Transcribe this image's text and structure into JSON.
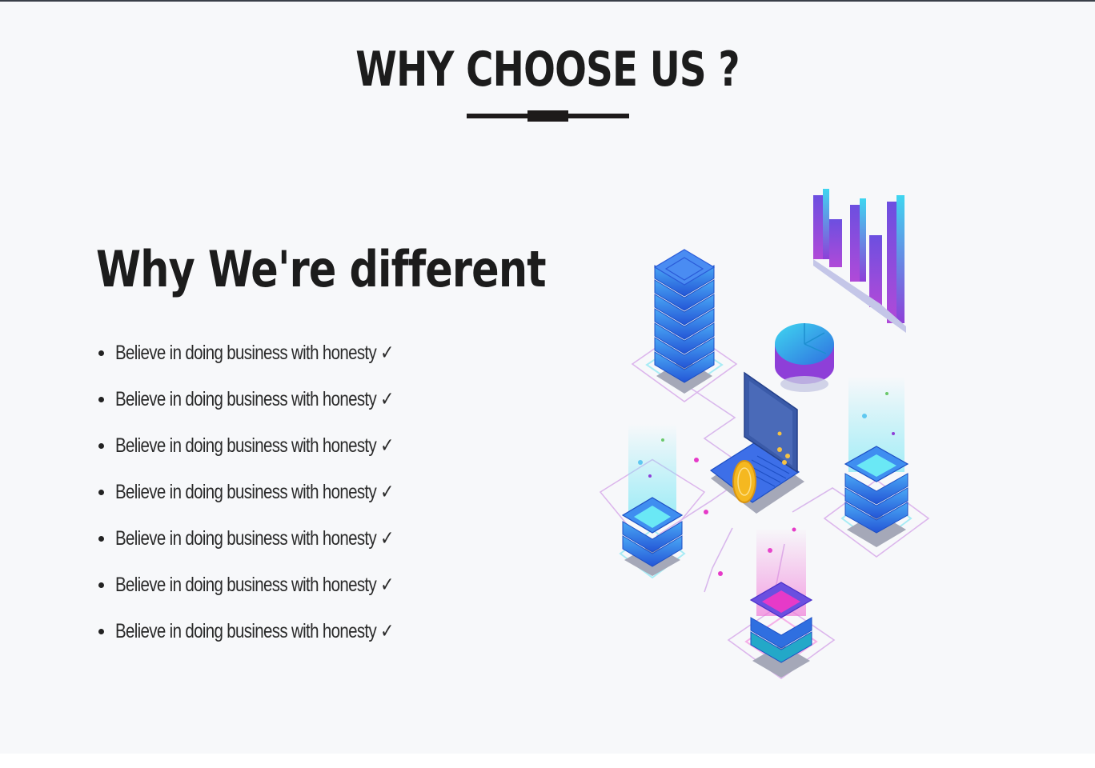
{
  "section": {
    "title": "WHY CHOOSE US ?",
    "subtitle": "Why We're different"
  },
  "features": [
    "Believe in doing business with honesty ✓",
    "Believe in doing business with honesty ✓",
    "Believe in doing business with honesty ✓",
    "Believe in doing business with honesty ✓",
    "Believe in doing business with honesty ✓",
    "Believe in doing business with honesty ✓",
    "Believe in doing business with honesty ✓"
  ],
  "colors": {
    "background": "#f7f8fa",
    "text": "#1c1c1c",
    "accent_blue": "#2f6fe0",
    "accent_cyan": "#3fd6f0",
    "accent_purple": "#8e3fd8",
    "accent_pink": "#e63ac8"
  },
  "illustration": {
    "icon": "isometric-servers-laptop-illustration"
  }
}
